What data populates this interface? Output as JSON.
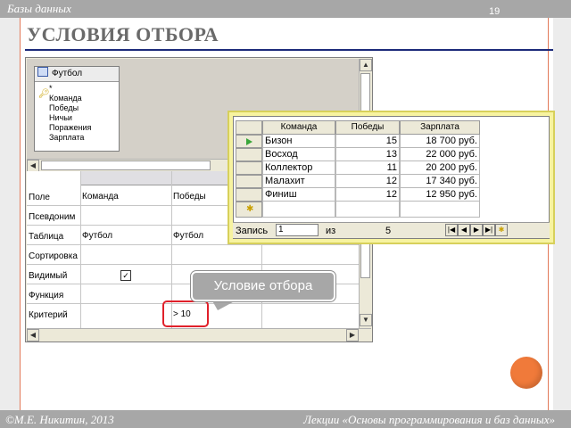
{
  "slide": {
    "section": "Базы данных",
    "number": "19",
    "title": "УСЛОВИЯ ОТБОРА",
    "footer_left": "©М.Е. Никитин, 2013",
    "footer_right": "Лекции «Основы программирования и баз данных»",
    "accent_color": "#f07a3a"
  },
  "query_designer": {
    "table_list": {
      "title": "Футбол",
      "icon": "table-icon",
      "fields": [
        "*",
        "Команда",
        "Победы",
        "Ничьи",
        "Поражения",
        "Зарплата"
      ],
      "key_field_icon": "key-icon"
    },
    "row_labels": [
      "Поле",
      "Псевдоним",
      "Таблица",
      "Сортировка",
      "Видимый",
      "Функция",
      "Критерий"
    ],
    "columns": [
      {
        "field": "Команда",
        "table": "Футбол",
        "visible": "✓",
        "criterion": ""
      },
      {
        "field": "Победы",
        "table": "Футбол",
        "visible": "",
        "criterion": "> 10"
      }
    ]
  },
  "callout": {
    "text": "Условие отбора"
  },
  "datasheet": {
    "headers": [
      "Команда",
      "Победы",
      "Зарплата"
    ],
    "rows": [
      {
        "team": "Бизон",
        "wins": "15",
        "salary": "18 700 руб."
      },
      {
        "team": "Восход",
        "wins": "13",
        "salary": "22 000 руб."
      },
      {
        "team": "Коллектор",
        "wins": "11",
        "salary": "20 200 руб."
      },
      {
        "team": "Малахит",
        "wins": "12",
        "salary": "17 340 руб."
      },
      {
        "team": "Финиш",
        "wins": "12",
        "salary": "12 950 руб."
      }
    ],
    "nav": {
      "record_label": "Запись",
      "record_value": "1",
      "of_label": "из",
      "total": "5"
    }
  }
}
